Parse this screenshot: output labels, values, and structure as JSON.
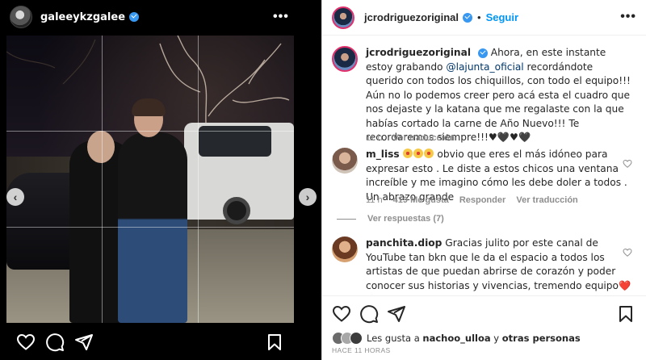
{
  "story": {
    "username": "galeeykzgalee",
    "more_icon": "more-horizontal-icon",
    "prev_arrow": "‹",
    "next_arrow": "›"
  },
  "post": {
    "author": "jcrodriguezoriginal",
    "follow_label": "Seguir",
    "caption_prefix": "Ahora, en este instante estoy grabando ",
    "caption_mention": "@lajunta_oficial",
    "caption_rest": " recordándote querido con todos los chiquillos, con todo el equipo!!! Aún no lo podemos creer pero acá esta el cuadro que nos dejaste y la katana que me regalaste con la que habías cortado la carne de Año Nuevo!!! Te recordaremos siempre!!!♥🖤♥🖤",
    "caption_time": "11 h",
    "caption_translate": "Ver traducción"
  },
  "comments": [
    {
      "username": "m_liss",
      "text": "obvio que eres el más idóneo para expresar esto . Le diste a estos chicos una ventana increíble y me imagino cómo les debe doler a todos . Un abrazo grande",
      "time": "11 h",
      "likes": "419 Me gusta",
      "reply": "Responder",
      "translate": "Ver traducción",
      "view_replies": "Ver respuestas (7)"
    },
    {
      "username": "panchita.diop",
      "text": "Gracias julito por este canal de YouTube tan bkn que le da el espacio a todos los artistas de que puedan abrirse de corazón y poder conocer sus historias y vivencias, tremendo equipo",
      "text_end": "❤️🙌"
    }
  ],
  "likes": {
    "prefix": "Les gusta a ",
    "user": "nachoo_ulloa",
    "middle": " y ",
    "others": "otras personas"
  },
  "timestamp": "HACE 11 HORAS",
  "colors": {
    "accent": "#0095f6",
    "verified": "#3897f0",
    "mention": "#00376b",
    "muted": "#8e8e8e"
  }
}
